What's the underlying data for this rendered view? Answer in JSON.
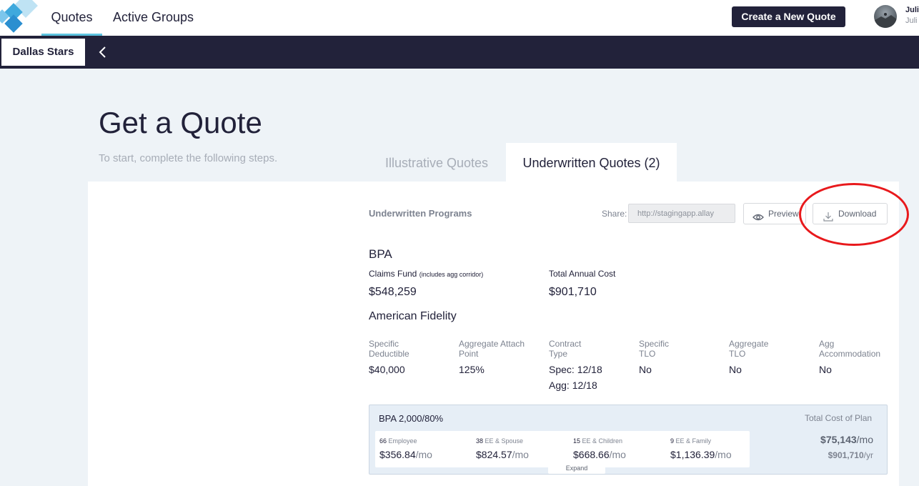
{
  "nav": {
    "tabs": [
      {
        "label": "Quotes"
      },
      {
        "label": "Active Groups"
      }
    ],
    "cta_label": "Create a New Quote",
    "user": {
      "name": "Juli",
      "sub": "Juli"
    }
  },
  "subnav": {
    "group_name": "Dallas Stars",
    "back_icon": "chevron-left-icon"
  },
  "page": {
    "title": "Get a Quote",
    "subtitle": "To start, complete the following steps."
  },
  "tabs": [
    {
      "label": "Illustrative Quotes"
    },
    {
      "label": "Underwritten Quotes (2)"
    }
  ],
  "toolbar": {
    "section_label": "Underwritten Programs",
    "share_label": "Share:",
    "share_url": "http://stagingapp.allay",
    "preview_label": "Preview",
    "download_label": "Download"
  },
  "program": {
    "name": "BPA",
    "claims_fund_label": "Claims Fund",
    "claims_fund_note": "(includes agg corridor)",
    "claims_fund_value": "$548,259",
    "annual_cost_label": "Total Annual Cost",
    "annual_cost_value": "$901,710",
    "provider": "American Fidelity",
    "details": [
      {
        "label": "Specific Deductible",
        "value": "$40,000"
      },
      {
        "label": "Aggregate Attach Point",
        "value": "125%"
      },
      {
        "label": "Contract Type",
        "value": "Spec: 12/18",
        "value2": "Agg: 12/18"
      },
      {
        "label": "Specific TLO",
        "value": "No"
      },
      {
        "label": "Aggregate TLO",
        "value": "No"
      },
      {
        "label": "Agg Accommodation",
        "value": "No"
      }
    ],
    "plan": {
      "name": "BPA 2,000/80%",
      "total_label": "Total Cost of Plan",
      "total_month": "$75,143",
      "month_unit": "/mo",
      "total_year": "$901,710",
      "year_unit": "/yr",
      "tiers": [
        {
          "count": "66",
          "label": "Employee",
          "price": "$356.84",
          "unit": "/mo"
        },
        {
          "count": "38",
          "label": "EE & Spouse",
          "price": "$824.57",
          "unit": "/mo"
        },
        {
          "count": "15",
          "label": "EE & Children",
          "price": "$668.66",
          "unit": "/mo"
        },
        {
          "count": "9",
          "label": "EE & Family",
          "price": "$1,136.39",
          "unit": "/mo"
        }
      ],
      "expand_label": "Expand"
    }
  },
  "colors": {
    "nav_dark": "#22223a",
    "accent": "#5ec3e0",
    "annotation": "#e8191c"
  }
}
